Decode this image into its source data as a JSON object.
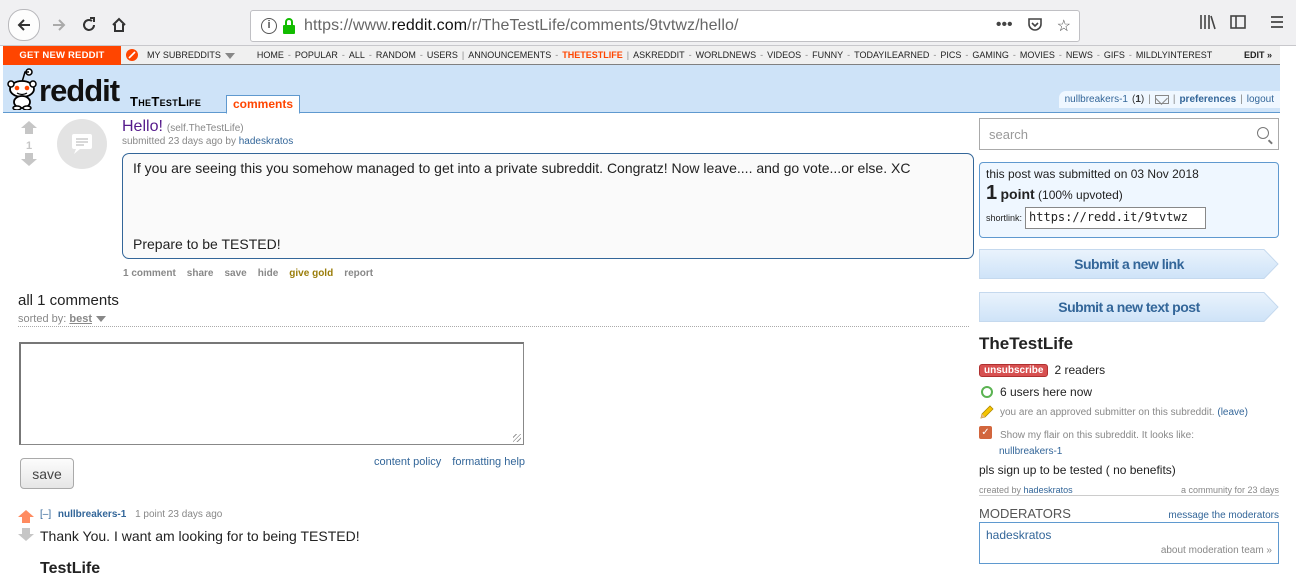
{
  "browser": {
    "url_prefix": "https://www.",
    "url_domain": "reddit.com",
    "url_path": "/r/TheTestLife/comments/9tvtwz/hello/"
  },
  "srbar": {
    "get_reddit": "GET NEW REDDIT",
    "my_subreddits": "MY SUBREDDITS",
    "links": [
      "HOME",
      "POPULAR",
      "ALL",
      "RANDOM",
      "USERS",
      "ANNOUNCEMENTS",
      "THETESTLIFE",
      "ASKREDDIT",
      "WORLDNEWS",
      "VIDEOS",
      "FUNNY",
      "TODAYILEARNED",
      "PICS",
      "GAMING",
      "MOVIES",
      "NEWS",
      "GIFS",
      "MILDLYINTEREST"
    ],
    "edit": "EDIT »"
  },
  "header": {
    "logo_text": "reddit",
    "subreddit_title": "TheTestLife",
    "tab_comments": "comments",
    "username": "nullbreakers-1",
    "karma": "1",
    "preferences": "preferences",
    "logout": "logout"
  },
  "post": {
    "score": "1",
    "title": "Hello!",
    "domain": "(self.TheTestLife)",
    "tagline_prefix": "submitted 23 days ago by",
    "author": "hadeskratos",
    "body_p1": "If you are seeing this you somehow managed to get into a private subreddit. Congratz! Now leave.... and go vote...or else. XC",
    "body_p2": "Prepare to be TESTED!",
    "actions": {
      "comments": "1 comment",
      "share": "share",
      "save": "save",
      "hide": "hide",
      "give_gold": "give gold",
      "report": "report"
    }
  },
  "comments_section": {
    "header": "all 1 comments",
    "sorted_by": "sorted by:",
    "sort_value": "best",
    "content_policy": "content policy",
    "formatting_help": "formatting help",
    "save_label": "save"
  },
  "comment": {
    "toggle": "[–]",
    "author": "nullbreakers-1",
    "meta": "1 point 23 days ago",
    "body": "Thank You. I want am looking for to being TESTED!",
    "cut_text": "TestLife"
  },
  "sidebar": {
    "search_placeholder": "search",
    "submitted_on": "this post was submitted on 03 Nov 2018",
    "points_num": "1",
    "points_word": "point",
    "upvoted": "(100% upvoted)",
    "shortlink_label": "shortlink:",
    "shortlink_value": "https://redd.it/9tvtwz",
    "submit_link": "Submit a new link",
    "submit_text": "Submit a new text post",
    "title": "TheTestLife",
    "unsubscribe": "unsubscribe",
    "readers": "2 readers",
    "online": "6 users here now",
    "approved_text": "you are an approved submitter on this subreddit.",
    "leave": "(leave)",
    "flair_text": "Show my flair on this subreddit. It looks like:",
    "flair_user": "nullbreakers-1",
    "description": "pls sign up to be tested ( no benefits)",
    "created_by_label": "created by",
    "created_by": "hadeskratos",
    "age": "a community for 23 days",
    "moderators_title": "MODERATORS",
    "message_mods": "message the moderators",
    "moderator": "hadeskratos",
    "about_mods": "about moderation team »"
  },
  "colors": {
    "accent": "#ff4500",
    "link": "#336699",
    "header_bg": "#cee3f8"
  }
}
